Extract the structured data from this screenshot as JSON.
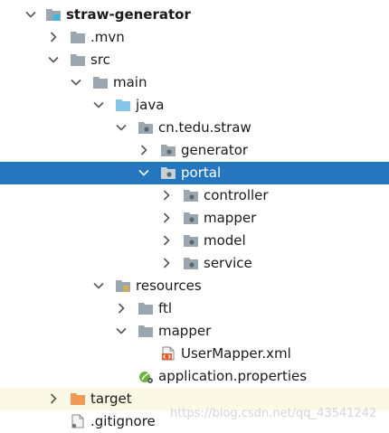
{
  "project_tree": {
    "items": [
      {
        "label": "straw-generator",
        "chevron": "down",
        "icon": "module-folder"
      },
      {
        "label": ".mvn",
        "chevron": "right",
        "icon": "folder"
      },
      {
        "label": "src",
        "chevron": "down",
        "icon": "folder"
      },
      {
        "label": "main",
        "chevron": "down",
        "icon": "folder"
      },
      {
        "label": "java",
        "chevron": "down",
        "icon": "source-root-folder"
      },
      {
        "label": "cn.tedu.straw",
        "chevron": "down",
        "icon": "package"
      },
      {
        "label": "generator",
        "chevron": "right",
        "icon": "package"
      },
      {
        "label": "portal",
        "chevron": "down",
        "icon": "package",
        "selected": true
      },
      {
        "label": "controller",
        "chevron": "right",
        "icon": "package"
      },
      {
        "label": "mapper",
        "chevron": "right",
        "icon": "package"
      },
      {
        "label": "model",
        "chevron": "right",
        "icon": "package"
      },
      {
        "label": "service",
        "chevron": "right",
        "icon": "package"
      },
      {
        "label": "resources",
        "chevron": "down",
        "icon": "resources-root-folder"
      },
      {
        "label": "ftl",
        "chevron": "right",
        "icon": "folder"
      },
      {
        "label": "mapper",
        "chevron": "down",
        "icon": "folder"
      },
      {
        "label": "UserMapper.xml",
        "chevron": "none",
        "icon": "xml-file"
      },
      {
        "label": "application.properties",
        "chevron": "none",
        "icon": "properties-file"
      },
      {
        "label": "target",
        "chevron": "right",
        "icon": "excluded-folder"
      },
      {
        "label": ".gitignore",
        "chevron": "none",
        "icon": "ignore-file"
      }
    ]
  },
  "watermark": "https://blog.csdn.net/qq_43541242",
  "colors": {
    "selection": "#2675bf",
    "excluded_row": "#fcf8e6",
    "folder": "#9aa7b0",
    "source_root": "#87c6e8",
    "excluded_folder": "#f09a55",
    "xml": "#e35e2b"
  }
}
